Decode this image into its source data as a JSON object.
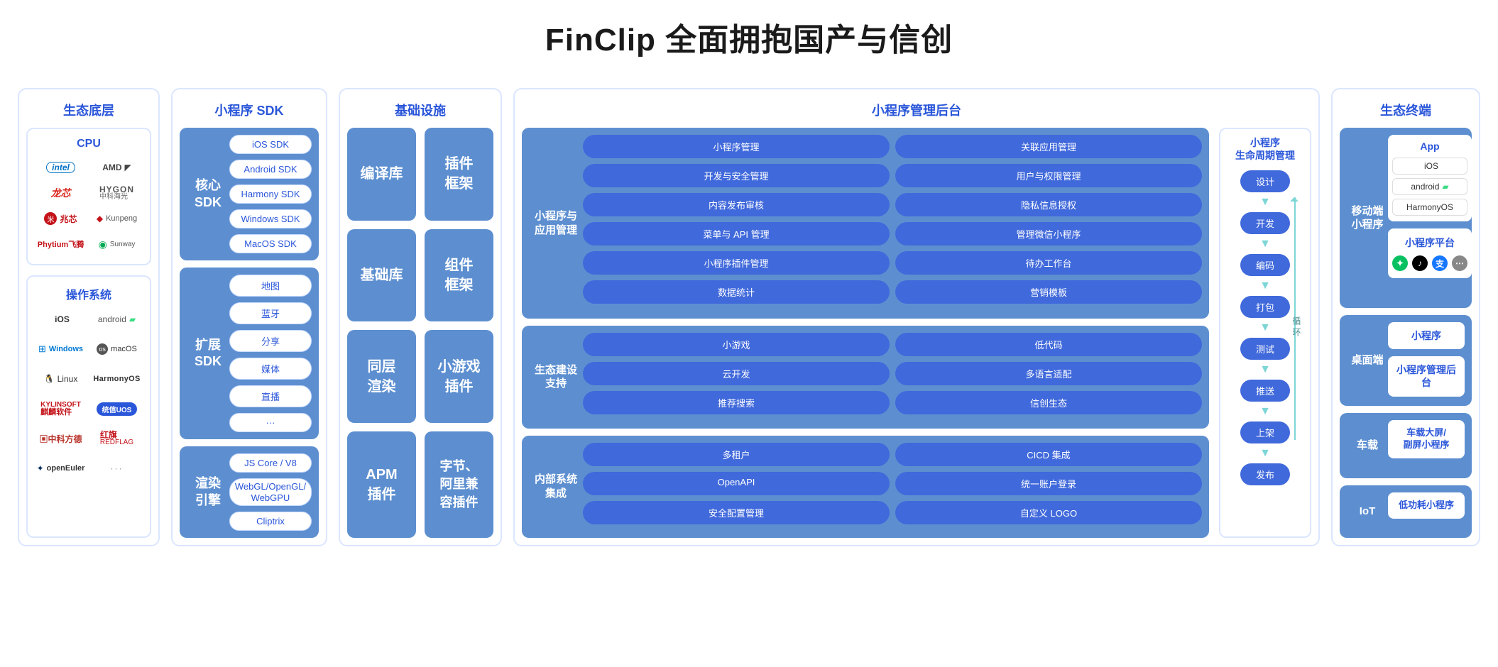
{
  "title": "FinClip 全面拥抱国产与信创",
  "col1": {
    "header": "生态底层",
    "cpu": {
      "header": "CPU",
      "logos": [
        "intel",
        "AMD",
        "龙芯",
        "HYGON",
        "兆芯",
        "Kunpeng",
        "Phytium飞腾",
        "Sunway"
      ]
    },
    "os": {
      "header": "操作系统",
      "logos": [
        "iOS",
        "android",
        "Windows",
        "macOS",
        "Linux",
        "HarmonyOS",
        "KylinSoft 麒麟软件",
        "统信UOS",
        "中科方德",
        "红旗 REDFLAG",
        "openEuler",
        "···"
      ]
    }
  },
  "col2": {
    "header": "小程序 SDK",
    "blocks": [
      {
        "label": "核心\nSDK",
        "items": [
          "iOS SDK",
          "Android SDK",
          "Harmony SDK",
          "Windows SDK",
          "MacOS SDK"
        ]
      },
      {
        "label": "扩展\nSDK",
        "items": [
          "地图",
          "蓝牙",
          "分享",
          "媒体",
          "直播",
          "···"
        ]
      },
      {
        "label": "渲染\n引擎",
        "items": [
          "JS Core / V8",
          "WebGL/OpenGL/\nWebGPU",
          "Cliptrix"
        ]
      }
    ]
  },
  "col3": {
    "header": "基础设施",
    "tiles": [
      "编译库",
      "插件\n框架",
      "基础库",
      "组件\n框架",
      "同层\n渲染",
      "小游戏\n插件",
      "APM\n插件",
      "字节、\n阿里兼\n容插件"
    ]
  },
  "col4": {
    "header": "小程序管理后台",
    "groups": [
      {
        "label": "小程序与\n应用管理",
        "items": [
          "小程序管理",
          "关联应用管理",
          "开发与安全管理",
          "用户与权限管理",
          "内容发布审核",
          "隐私信息授权",
          "菜单与 API 管理",
          "管理微信小程序",
          "小程序插件管理",
          "待办工作台",
          "数据统计",
          "营销模板"
        ]
      },
      {
        "label": "生态建设\n支持",
        "items": [
          "小游戏",
          "低代码",
          "云开发",
          "多语言适配",
          "推荐搜索",
          "信创生态"
        ]
      },
      {
        "label": "内部系统\n集成",
        "items": [
          "多租户",
          "CICD 集成",
          "OpenAPI",
          "统一账户登录",
          "安全配置管理",
          "自定义 LOGO"
        ]
      }
    ],
    "lifecycle": {
      "header": "小程序\n生命周期管理",
      "steps": [
        "设计",
        "开发",
        "编码",
        "打包",
        "测试",
        "推送",
        "上架",
        "发布"
      ],
      "loop_label": "循环"
    }
  },
  "col5": {
    "header": "生态终端",
    "mobile": {
      "label": "移动端\n小程序",
      "app_header": "App",
      "os": [
        "iOS",
        "android",
        "HarmonyOS"
      ],
      "platform_header": "小程序平台"
    },
    "desktop": {
      "label": "桌面端",
      "items": [
        "小程序",
        "小程序管理后台"
      ]
    },
    "car": {
      "label": "车载",
      "items": [
        "车载大屏/\n副屏小程序"
      ]
    },
    "iot": {
      "label": "IoT",
      "items": [
        "低功耗小程序"
      ]
    }
  }
}
